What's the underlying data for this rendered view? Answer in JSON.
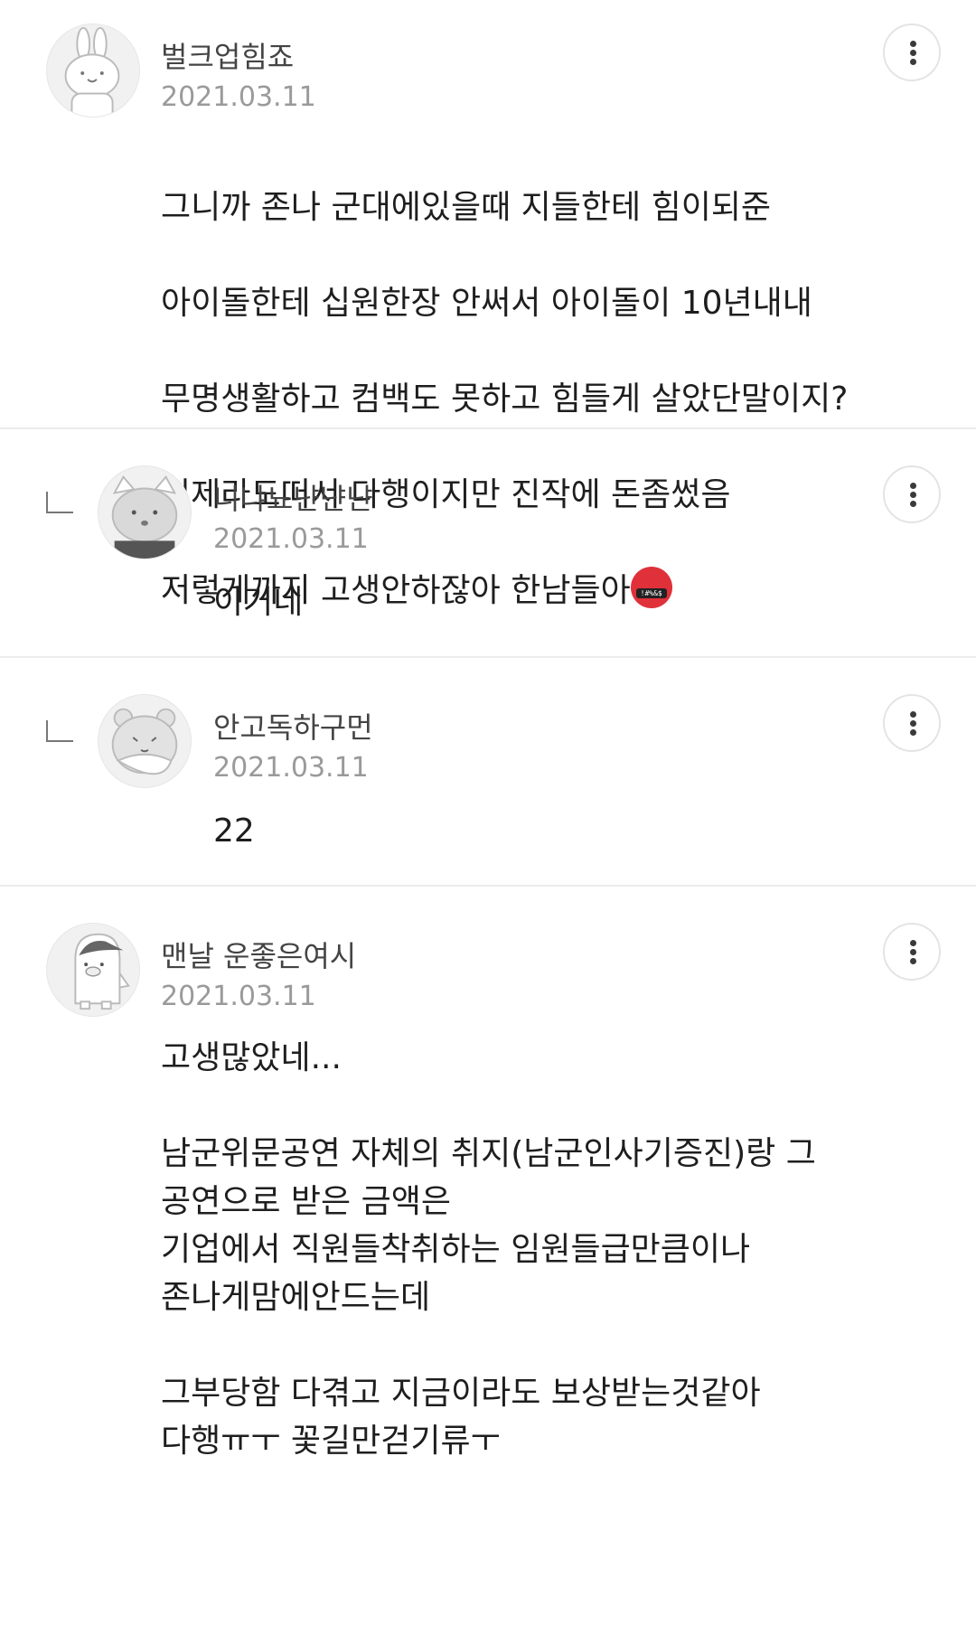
{
  "comments": [
    {
      "username": "벌크업힘죠",
      "date": "2021.03.11",
      "avatar_icon": "bunny-avatar-icon",
      "lines": [
        "그니까 존나 군대에있을때 지들한테 힘이되준",
        "아이돌한테 십원한장 안써서 아이돌이 10년내내",
        "무명생활하고 컴백도 못하고 힘들게 살았단말이지?",
        "이제라도떠서 다행이지만 진작에 돈좀썼음",
        "저렇게까지 고생안하잖아 한남들아"
      ],
      "emoji": "🤬",
      "emoji_icon": "face-with-symbols-on-mouth-icon"
    },
    {
      "username": "니냐뇨냔냔냔",
      "date": "2021.03.11",
      "avatar_icon": "cat-avatar-icon",
      "text": "이거네"
    },
    {
      "username": "안고독하구먼",
      "date": "2021.03.11",
      "avatar_icon": "bear-avatar-icon",
      "text": "22"
    },
    {
      "username": "맨날 운좋은여시",
      "date": "2021.03.11",
      "avatar_icon": "penguin-avatar-icon",
      "text": "고생많았네...\n\n남군위문공연 자체의 취지(남군인사기증진)랑 그\n공연으로 받은 금액은\n기업에서 직원들착취하는 임원들급만큼이나\n존나게맘에안드는데\n\n그부당함 다겪고 지금이라도 보상받는것같아\n다행ㅠㅜ 꽃길만걷기류ㅜ"
    }
  ],
  "icons": {
    "more": "more-vertical-icon",
    "reply": "reply-arrow-icon"
  }
}
